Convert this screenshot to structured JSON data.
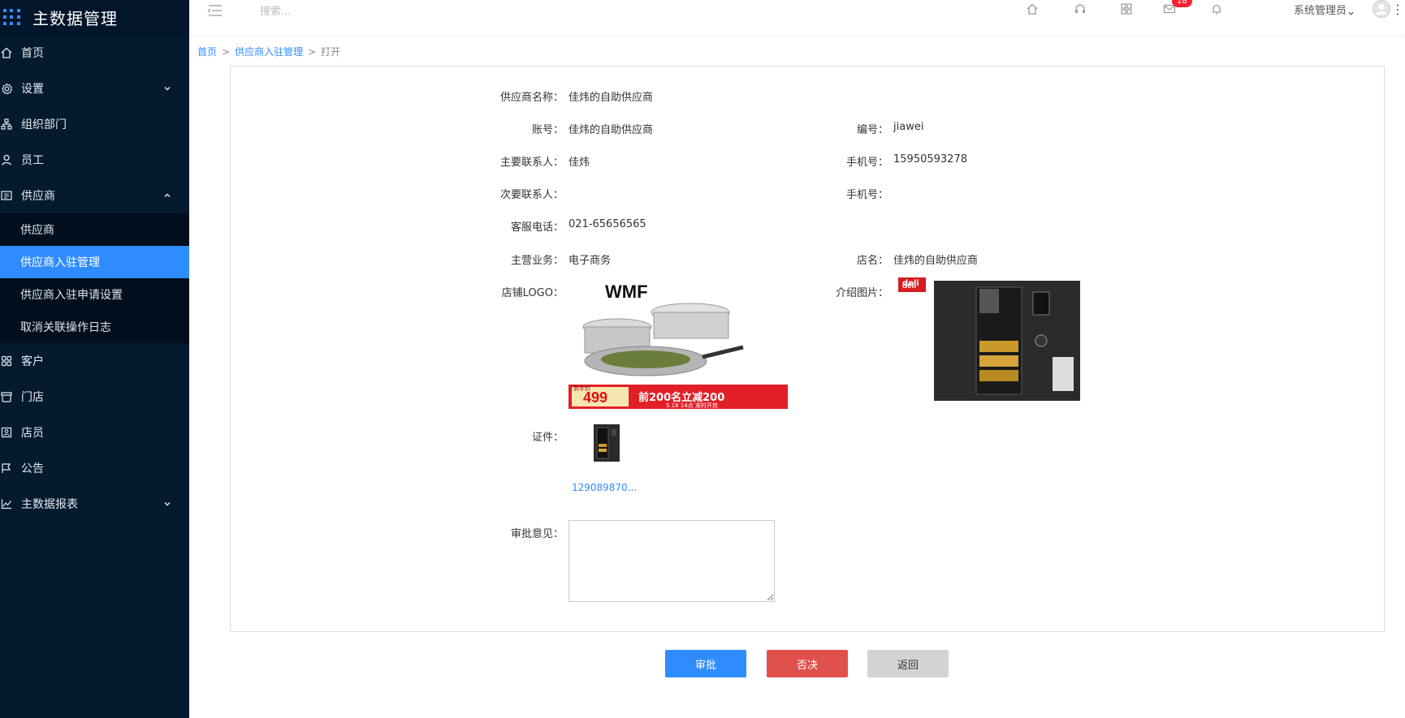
{
  "app": {
    "title": "主数据管理"
  },
  "sidebar": {
    "items": [
      {
        "label": "首页",
        "icon": "home-icon"
      },
      {
        "label": "设置",
        "icon": "gear-icon",
        "expandable": true
      },
      {
        "label": "组织部门",
        "icon": "org-icon"
      },
      {
        "label": "员工",
        "icon": "user-icon"
      },
      {
        "label": "供应商",
        "icon": "supplier-icon",
        "expanded": true
      }
    ],
    "sub_items": [
      {
        "label": "供应商"
      },
      {
        "label": "供应商入驻管理",
        "active": true
      },
      {
        "label": "供应商入驻申请设置"
      },
      {
        "label": "取消关联操作日志"
      }
    ],
    "items_after": [
      {
        "label": "客户",
        "icon": "customer-icon"
      },
      {
        "label": "门店",
        "icon": "store-icon"
      },
      {
        "label": "店员",
        "icon": "clerk-icon"
      },
      {
        "label": "公告",
        "icon": "announcement-icon"
      },
      {
        "label": "主数据报表",
        "icon": "report-icon",
        "expandable": true
      }
    ]
  },
  "topbar": {
    "search_placeholder": "搜索...",
    "message_badge": "18",
    "user_name": "系统管理员"
  },
  "breadcrumb": {
    "home": "首页",
    "parent": "供应商入驻管理",
    "current": "打开",
    "separator": ">"
  },
  "form": {
    "supplier_name_label": "供应商名称：",
    "supplier_name": "佳炜的自助供应商",
    "account_label": "账号：",
    "account": "佳炜的自助供应商",
    "code_label": "编号：",
    "code": "jiawei",
    "primary_contact_label": "主要联系人：",
    "primary_contact": "佳炜",
    "mobile_label": "手机号：",
    "mobile": "15950593278",
    "secondary_contact_label": "次要联系人：",
    "secondary_contact": "",
    "mobile2_label": "手机号：",
    "mobile2": "",
    "service_phone_label": "客服电话：",
    "service_phone": "021-65656565",
    "main_business_label": "主营业务：",
    "main_business": "电子商务",
    "shop_name_label": "店名：",
    "shop_name": "佳炜的自助供应商",
    "shop_logo_label": "店铺LOGO：",
    "logo_image": {
      "brand": "WMF",
      "price": "499",
      "promo": "前200名立减200",
      "promo_sub": "5.18 14点 准时开抢",
      "tag": "到手价"
    },
    "intro_image_label": "介绍图片：",
    "intro_image": {
      "brand": "deli"
    },
    "certificate_label": "证件：",
    "certificate_file": "129089870...",
    "remark_label": "审批意见：",
    "remark_value": ""
  },
  "actions": {
    "approve": "审批",
    "reject": "否决",
    "back": "返回"
  },
  "colors": {
    "sidebar_bg": "#041a2f",
    "accent": "#2f8cff",
    "danger": "#e0504d",
    "neutral": "#d3d3d3"
  }
}
